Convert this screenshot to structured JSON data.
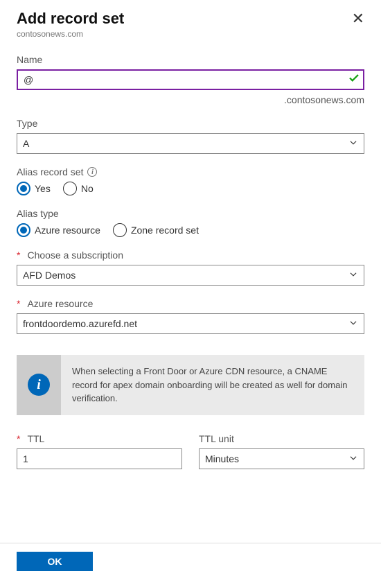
{
  "header": {
    "title": "Add record set",
    "subtitle": "contosonews.com"
  },
  "name": {
    "label": "Name",
    "value": "@",
    "domain_suffix": ".contosonews.com"
  },
  "type": {
    "label": "Type",
    "value": "A"
  },
  "alias_record_set": {
    "label": "Alias record set",
    "options": {
      "yes": "Yes",
      "no": "No"
    },
    "selected": "yes"
  },
  "alias_type": {
    "label": "Alias type",
    "options": {
      "azure_resource": "Azure resource",
      "zone_record_set": "Zone record set"
    },
    "selected": "azure_resource"
  },
  "subscription": {
    "label": "Choose a subscription",
    "value": "AFD Demos"
  },
  "azure_resource": {
    "label": "Azure resource",
    "value": "frontdoordemo.azurefd.net"
  },
  "info_banner": {
    "text": "When selecting a Front Door or Azure CDN resource, a CNAME record for apex domain onboarding will be created as well for domain verification."
  },
  "ttl": {
    "label": "TTL",
    "value": "1",
    "unit_label": "TTL unit",
    "unit_value": "Minutes"
  },
  "footer": {
    "ok": "OK"
  }
}
